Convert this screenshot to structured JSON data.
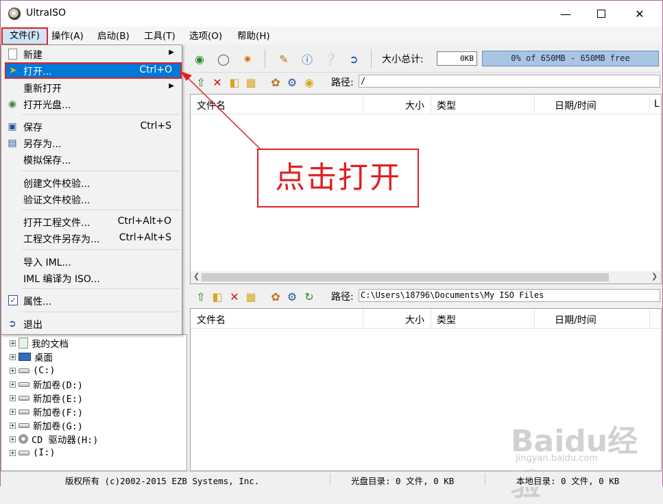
{
  "window": {
    "title": "UltraISO"
  },
  "menubar": [
    {
      "label": "文件(F)"
    },
    {
      "label": "操作(A)"
    },
    {
      "label": "启动(B)"
    },
    {
      "label": "工具(T)"
    },
    {
      "label": "选项(O)"
    },
    {
      "label": "帮助(H)"
    }
  ],
  "toolbar": {
    "size_label": "大小总计:",
    "size_value": "0KB",
    "capacity_text": "0% of 650MB - 650MB free"
  },
  "file_menu": {
    "items": [
      {
        "label": "新建",
        "shortcut": "",
        "submenu": true
      },
      {
        "label": "打开...",
        "shortcut": "Ctrl+O",
        "submenu": false
      },
      {
        "label": "重新打开",
        "shortcut": "",
        "submenu": true
      },
      {
        "label": "打开光盘...",
        "shortcut": "",
        "submenu": false
      },
      {
        "label": "保存",
        "shortcut": "Ctrl+S",
        "submenu": false
      },
      {
        "label": "另存为...",
        "shortcut": "",
        "submenu": false
      },
      {
        "label": "模拟保存...",
        "shortcut": "",
        "submenu": false
      },
      {
        "label": "创建文件校验...",
        "shortcut": "",
        "submenu": false
      },
      {
        "label": "验证文件校验...",
        "shortcut": "",
        "submenu": false
      },
      {
        "label": "打开工程文件...",
        "shortcut": "Ctrl+Alt+O",
        "submenu": false
      },
      {
        "label": "工程文件另存为...",
        "shortcut": "Ctrl+Alt+S",
        "submenu": false
      },
      {
        "label": "导入 IML...",
        "shortcut": "",
        "submenu": false
      },
      {
        "label": "IML 编译为 ISO...",
        "shortcut": "",
        "submenu": false
      },
      {
        "label": "属性...",
        "shortcut": "",
        "submenu": false
      },
      {
        "label": "退出",
        "shortcut": "",
        "submenu": false
      }
    ]
  },
  "iso_pane": {
    "path_label": "路径:",
    "path_value": "/",
    "columns": [
      "文件名",
      "大小",
      "类型",
      "日期/时间",
      "L"
    ]
  },
  "local_pane": {
    "path_label": "路径:",
    "path_value": "C:\\Users\\18796\\Documents\\My ISO Files",
    "columns": [
      "文件名",
      "大小",
      "类型",
      "日期/时间"
    ]
  },
  "tree": {
    "items": [
      {
        "label": "我的文档",
        "icon": "documents-icon"
      },
      {
        "label": "桌面",
        "icon": "desktop-icon"
      },
      {
        "label": "(C:)",
        "icon": "drive-icon"
      },
      {
        "label": "新加卷(D:)",
        "icon": "drive-icon"
      },
      {
        "label": "新加卷(E:)",
        "icon": "drive-icon"
      },
      {
        "label": "新加卷(F:)",
        "icon": "drive-icon"
      },
      {
        "label": "新加卷(G:)",
        "icon": "drive-icon"
      },
      {
        "label": "CD 驱动器(H:)",
        "icon": "cd-drive-icon"
      },
      {
        "label": "(I:)",
        "icon": "drive-icon"
      }
    ]
  },
  "statusbar": {
    "copyright": "版权所有 (c)2002-2015 EZB Systems, Inc.",
    "disc_dir": "光盘目录: 0 文件, 0 KB",
    "local_dir": "本地目录: 0 文件, 0 KB"
  },
  "annotation": {
    "text": "点击打开"
  },
  "watermark": {
    "text": "Baidu经验",
    "sub": "jingyan.baidu.com"
  },
  "colors": {
    "highlight": "#0078d7",
    "annotation": "#e02020",
    "capacity_bar": "#a9c5e6"
  }
}
